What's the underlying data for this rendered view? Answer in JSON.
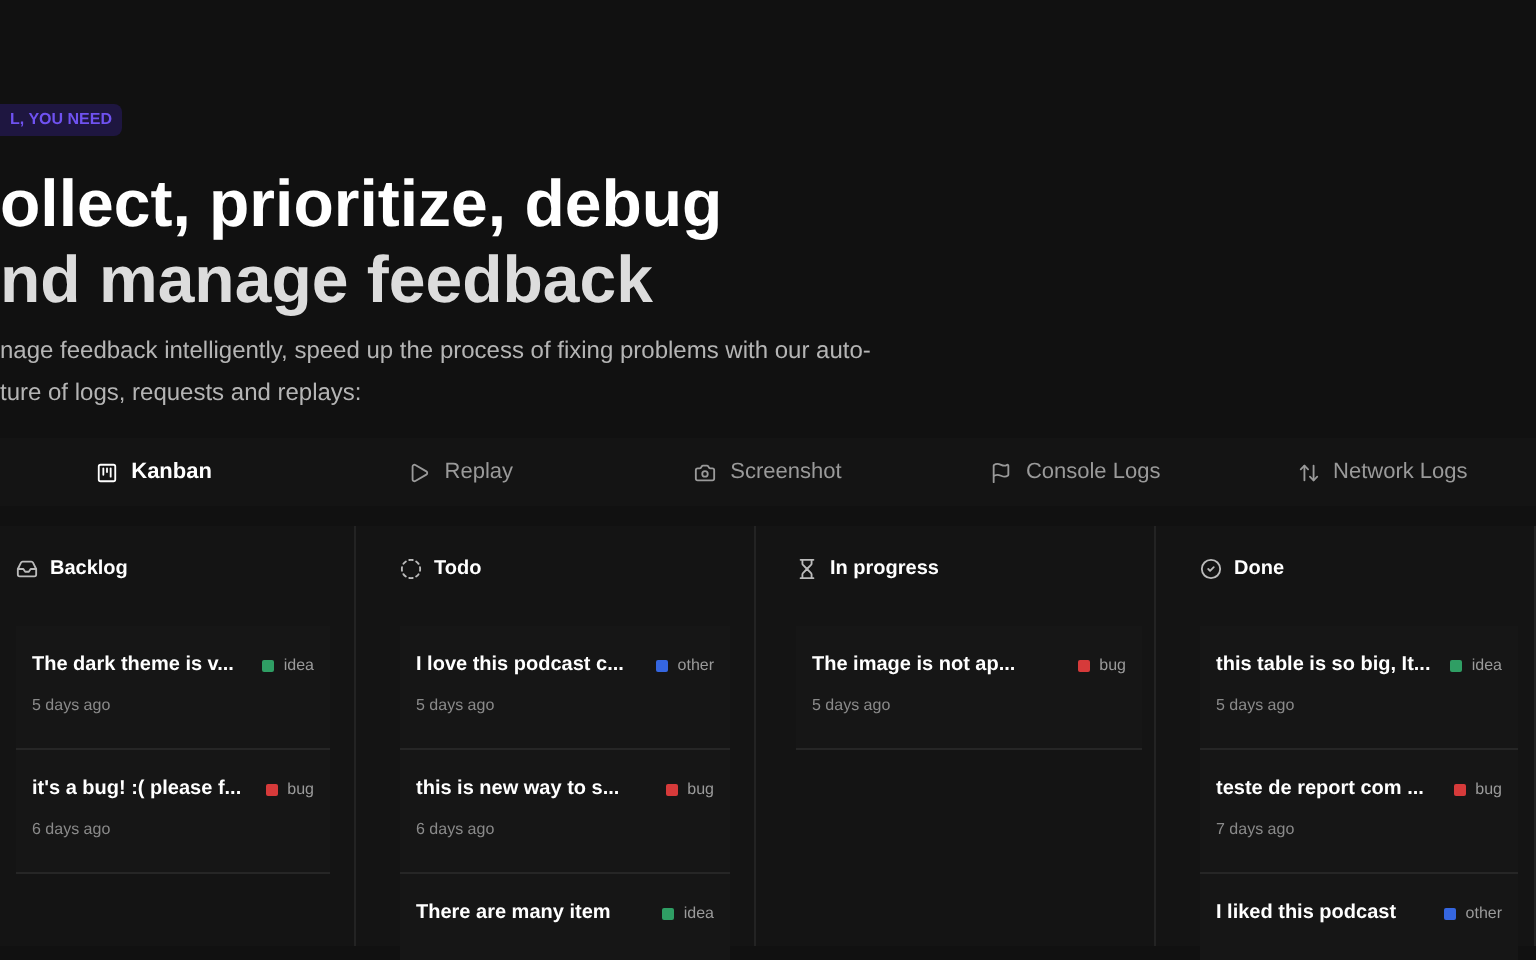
{
  "badge": "L, YOU NEED",
  "headline": [
    "ollect, prioritize, debug",
    "nd manage feedback"
  ],
  "description": [
    "nage feedback intelligently, speed up the process of fixing problems with our auto-",
    "ture of logs, requests and replays:"
  ],
  "tabs": [
    {
      "label": "Kanban",
      "selected": true
    },
    {
      "label": "Replay",
      "selected": false
    },
    {
      "label": "Screenshot",
      "selected": false
    },
    {
      "label": "Console Logs",
      "selected": false
    },
    {
      "label": "Network Logs",
      "selected": false
    }
  ],
  "columns": [
    {
      "title": "Backlog",
      "cards": [
        {
          "title": "The dark theme is v...",
          "tag": "idea",
          "color": "#2f9e64",
          "time": "5 days ago"
        },
        {
          "title": "it's a bug! :( please f...",
          "tag": "bug",
          "color": "#d63a3a",
          "time": "6 days ago"
        }
      ]
    },
    {
      "title": "Todo",
      "cards": [
        {
          "title": "I love this podcast c...",
          "tag": "other",
          "color": "#3566e0",
          "time": "5 days ago"
        },
        {
          "title": "this is new way to s...",
          "tag": "bug",
          "color": "#d63a3a",
          "time": "6 days ago"
        },
        {
          "title": "There are many item",
          "tag": "idea",
          "color": "#2f9e64"
        }
      ]
    },
    {
      "title": "In progress",
      "cards": [
        {
          "title": "The image is not ap...",
          "tag": "bug",
          "color": "#d63a3a",
          "time": "5 days ago"
        }
      ]
    },
    {
      "title": "Done",
      "cards": [
        {
          "title": "this table is so big, It...",
          "tag": "idea",
          "color": "#2f9e64",
          "time": "5 days ago"
        },
        {
          "title": "teste de report com ...",
          "tag": "bug",
          "color": "#d63a3a",
          "time": "7 days ago"
        },
        {
          "title": "I liked this podcast",
          "tag": "other",
          "color": "#3566e0"
        }
      ]
    }
  ]
}
